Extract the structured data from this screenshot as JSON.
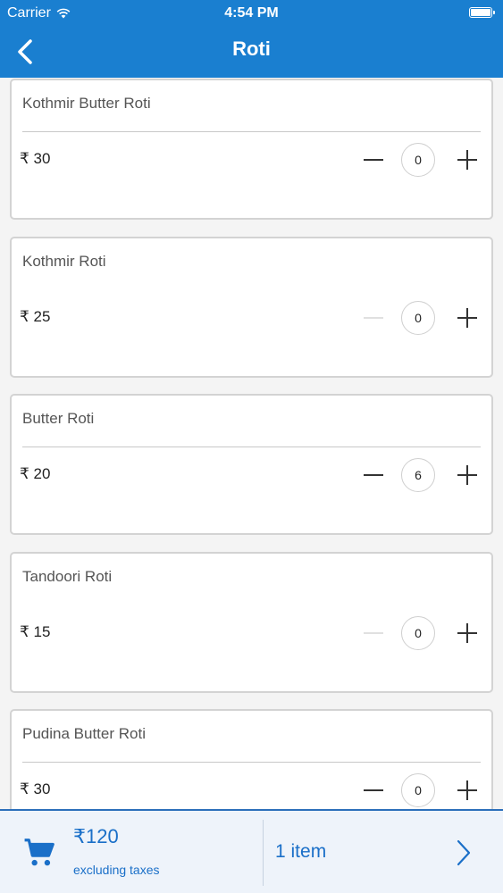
{
  "status_bar": {
    "carrier": "Carrier",
    "time": "4:54 PM"
  },
  "navbar": {
    "title": "Roti",
    "back_icon": "chevron-left-icon"
  },
  "currency_symbol": "₹",
  "items": [
    {
      "name": "Kothmir Butter Roti",
      "price": "₹ 30",
      "quantity": "0",
      "minus_enabled": true
    },
    {
      "name": "Kothmir Roti",
      "price": "₹ 25",
      "quantity": "0",
      "minus_enabled": false
    },
    {
      "name": "Butter Roti",
      "price": "₹ 20",
      "quantity": "6",
      "minus_enabled": true
    },
    {
      "name": "Tandoori Roti",
      "price": "₹ 15",
      "quantity": "0",
      "minus_enabled": false
    },
    {
      "name": "Pudina Butter Roti",
      "price": "₹ 30",
      "quantity": "0",
      "minus_enabled": true
    }
  ],
  "cart": {
    "total": "₹120",
    "note": "excluding taxes",
    "count_label": "1 item",
    "icon": "cart-icon"
  },
  "colors": {
    "accent": "#1a7fd0",
    "cart_text": "#1a6fc8"
  }
}
